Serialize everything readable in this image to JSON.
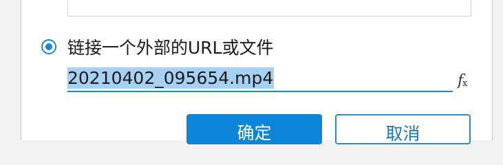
{
  "dialog": {
    "radio_option": {
      "label": "链接一个外部的URL或文件",
      "selected": true
    },
    "url_field": {
      "value": "20210402_095654.mp4"
    },
    "formula_icon": "fx-icon",
    "buttons": {
      "ok_label": "确定",
      "cancel_label": "取消"
    },
    "colors": {
      "accent": "#1688d4",
      "primary_button": "#0c85d8",
      "selection": "#a6d1f5"
    }
  }
}
